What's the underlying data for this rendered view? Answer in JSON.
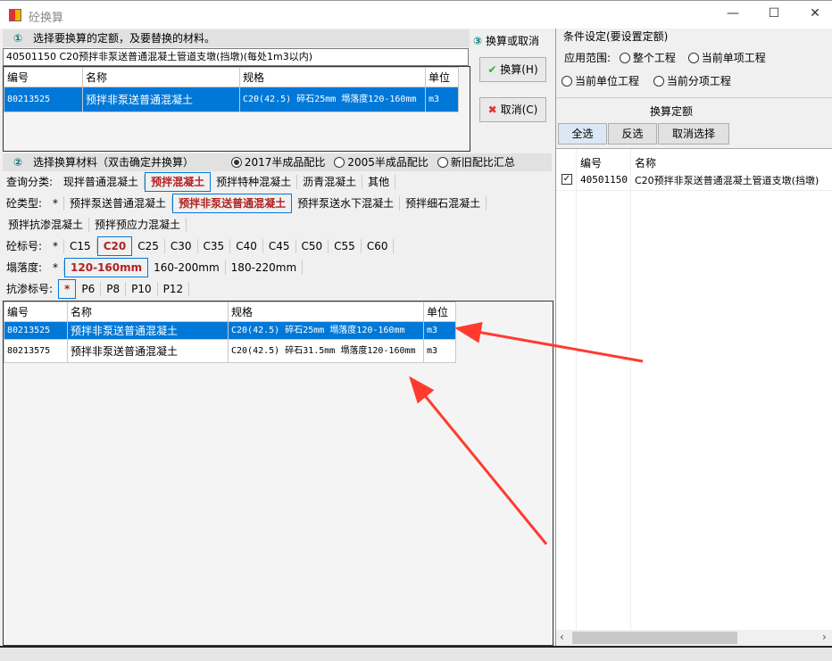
{
  "window": {
    "title": "砼换算",
    "minimize": "—",
    "maximize": "☐",
    "close": "✕"
  },
  "section1": {
    "num": "①",
    "title": "选择要换算的定额，及要替换的材料。",
    "quota_field": "40501150     C20预拌非泵送普通混凝土管道支墩(挡墩)(每处1m3以内)",
    "columns": [
      "编号",
      "名称",
      "规格",
      "单位"
    ],
    "rows": [
      {
        "code": "80213525",
        "name": "预拌非泵送普通混凝土",
        "spec": "C20(42.5) 碎石25mm 塌落度120-160mm",
        "unit": "m3"
      }
    ]
  },
  "section3": {
    "num": "③",
    "title": "换算或取消",
    "convert_label": "换算(H)",
    "cancel_label": "取消(C)"
  },
  "section2": {
    "num": "②",
    "title": "选择换算材料（双击确定并换算）",
    "ratio_options": [
      {
        "label": "2017半成品配比",
        "checked": true
      },
      {
        "label": "2005半成品配比",
        "checked": false
      },
      {
        "label": "新旧配比汇总",
        "checked": false
      }
    ],
    "filters": [
      {
        "label": "查询分类:",
        "options": [
          "现拌普通混凝土",
          "预拌混凝土",
          "预拌特种混凝土",
          "沥青混凝土",
          "其他"
        ],
        "active": "预拌混凝土"
      },
      {
        "label": "砼类型:",
        "options": [
          "*",
          "预拌泵送普通混凝土",
          "预拌非泵送普通混凝土",
          "预拌泵送水下混凝土",
          "预拌细石混凝土"
        ],
        "active": "预拌非泵送普通混凝土"
      },
      {
        "label": "",
        "options": [
          "预拌抗渗混凝土",
          "预拌预应力混凝土"
        ],
        "active": ""
      },
      {
        "label": "砼标号:",
        "options": [
          "*",
          "C15",
          "C20",
          "C25",
          "C30",
          "C35",
          "C40",
          "C45",
          "C50",
          "C55",
          "C60"
        ],
        "active": "C20"
      },
      {
        "label": "塌落度:",
        "options": [
          "*",
          "120-160mm",
          "160-200mm",
          "180-220mm"
        ],
        "active": "120-160mm"
      },
      {
        "label": "抗渗标号:",
        "options": [
          "*",
          "P6",
          "P8",
          "P10",
          "P12"
        ],
        "active": "*"
      }
    ],
    "columns": [
      "编号",
      "名称",
      "规格",
      "单位"
    ],
    "rows": [
      {
        "code": "80213525",
        "name": "预拌非泵送普通混凝土",
        "spec": "C20(42.5) 碎石25mm 塌落度120-160mm",
        "unit": "m3",
        "selected": true
      },
      {
        "code": "80213575",
        "name": "预拌非泵送普通混凝土",
        "spec": "C20(42.5) 碎石31.5mm 塌落度120-160mm",
        "unit": "m3",
        "selected": false
      }
    ]
  },
  "conditions": {
    "title": "条件设定(要设置定额)",
    "scope_label": "应用范围:",
    "scope_options": [
      "整个工程",
      "当前单项工程",
      "当前单位工程",
      "当前分项工程"
    ],
    "quota_title": "换算定额",
    "select_all": "全选",
    "invert": "反选",
    "deselect": "取消选择",
    "columns": [
      "编号",
      "名称"
    ],
    "rows": [
      {
        "checked": true,
        "code": "40501150",
        "name": "C20预拌非泵送普通混凝土管道支墩(挡墩)"
      }
    ]
  },
  "colors": {
    "selection": "#0078d7",
    "active_filter": "#b22222",
    "arrow": "#ff3b30"
  }
}
